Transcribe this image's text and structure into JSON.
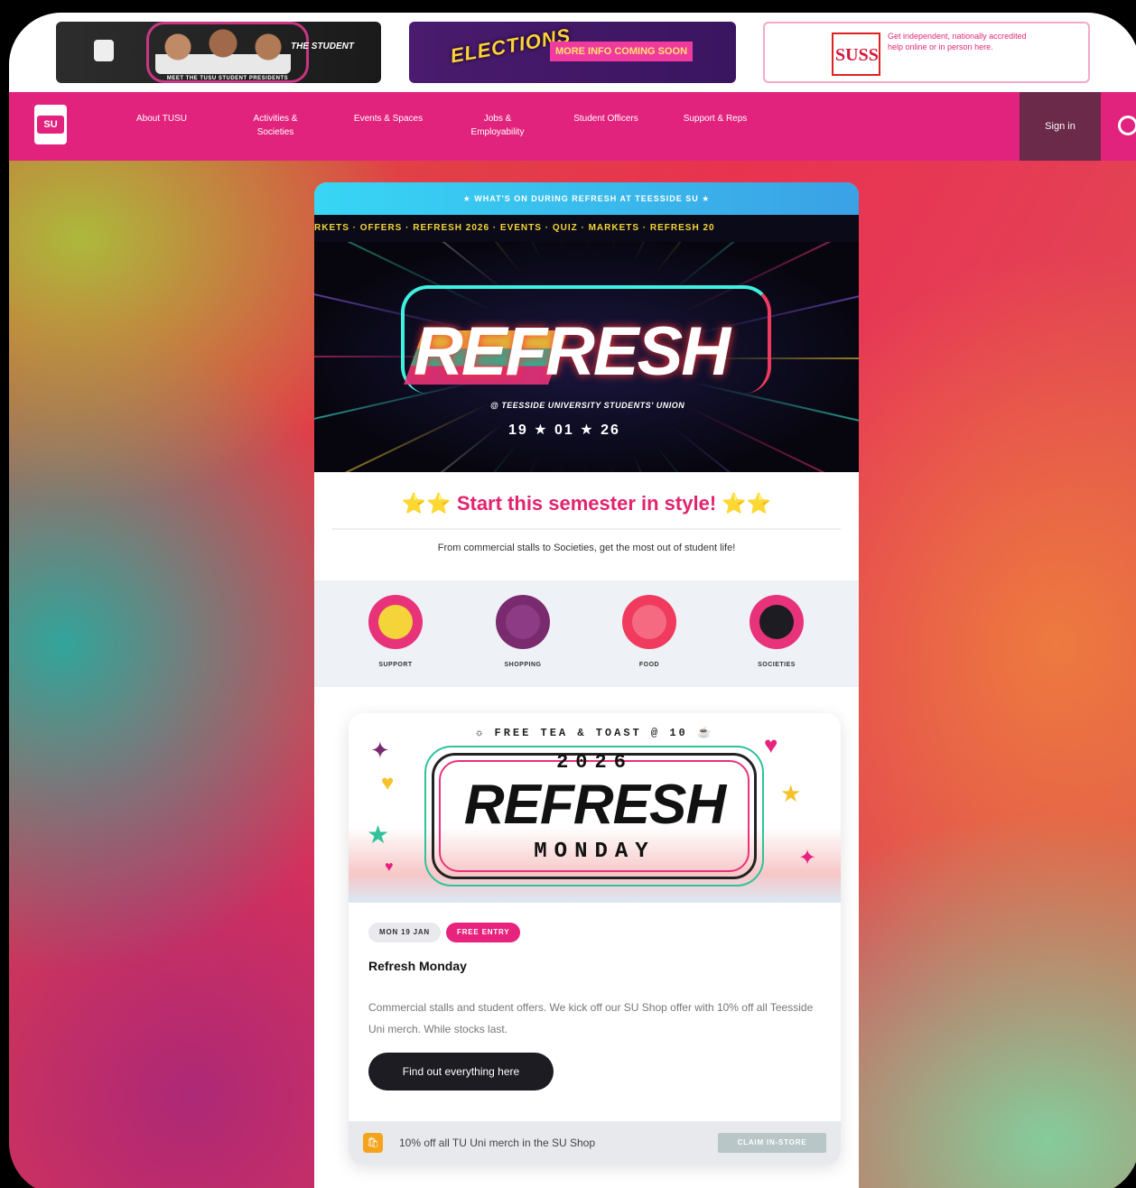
{
  "banners": {
    "presidents_caption": "MEET THE TUSU STUDENT PRESIDENTS",
    "presidents_tag": "THE STUDENT",
    "elections_title": "ELECTIONS",
    "elections_cta": "MORE INFO COMING SOON",
    "suss_logo": "SUSS",
    "suss_text": "Get independent, nationally accredited help online or in person here."
  },
  "nav": {
    "logo": "SU",
    "items": [
      {
        "label": "About TUSU"
      },
      {
        "label": "Activities & Societies"
      },
      {
        "label": "Events & Spaces"
      },
      {
        "label": "Jobs & Employability"
      },
      {
        "label": "Student Officers"
      },
      {
        "label": "Support & Reps"
      }
    ],
    "signin": "Sign in"
  },
  "card": {
    "header": "★ WHAT'S ON DURING REFRESH AT TEESSIDE SU ★",
    "ticker": "RKETS · OFFERS · REFRESH 2026 · EVENTS · QUIZ · MARKETS · REFRESH 20",
    "hero": {
      "brand": "REFRESH",
      "sub": "@ TEESSIDE UNIVERSITY STUDENTS' UNION",
      "date": "19 ★ 01 ★ 26"
    },
    "headline": "⭐⭐ Start this semester in style! ⭐⭐",
    "intro": "From commercial stalls to Societies, get the most out of student life!",
    "categories": [
      {
        "label": "SUPPORT",
        "color": "#e8327a",
        "inner": "#f5d43a"
      },
      {
        "label": "SHOPPING",
        "color": "#7a2a6e",
        "inner": "#8e3b86"
      },
      {
        "label": "FOOD",
        "color": "#f03a5e",
        "inner": "#f56a80"
      },
      {
        "label": "SOCIETIES",
        "color": "#e8327a",
        "inner": "#1c1c22"
      }
    ]
  },
  "event": {
    "image_top": "☼ FREE TEA & TOAST @ 10 ☕",
    "image_year": "2026",
    "image_brand": "REFRESH",
    "image_day": "MONDAY",
    "tag_date": "MON 19 JAN",
    "tag_free": "FREE ENTRY",
    "title": "Refresh Monday",
    "description": "Commercial stalls and student offers. We kick off our SU Shop offer with 10% off all Teesside Uni merch. While stocks last.",
    "button": "Find out everything here",
    "offer_text": "10% off all TU Uni merch in the SU Shop",
    "offer_claim": "CLAIM IN-STORE"
  }
}
